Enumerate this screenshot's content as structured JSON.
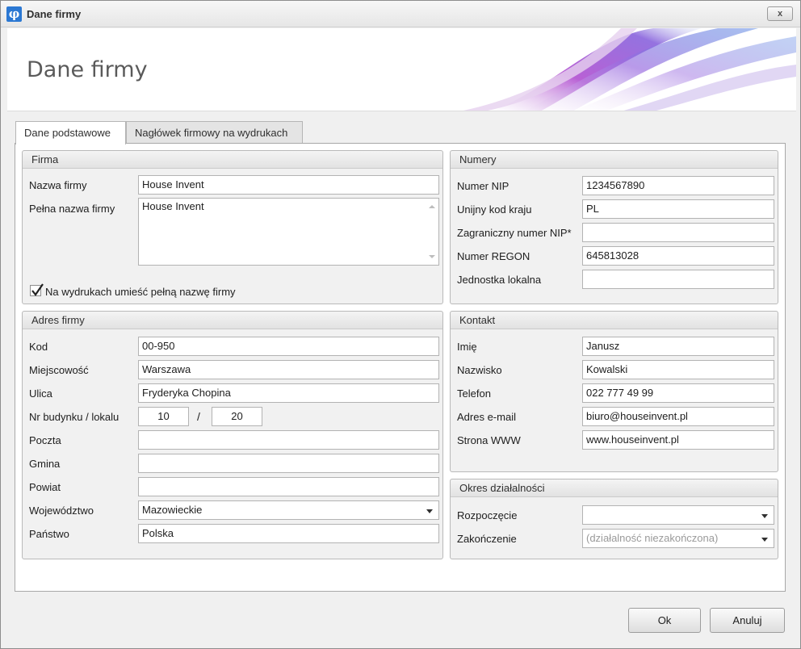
{
  "window": {
    "title": "Dane firmy",
    "close_label": "x"
  },
  "header": {
    "title": "Dane firmy"
  },
  "tabs": [
    {
      "label": "Dane podstawowe"
    },
    {
      "label": "Nagłówek firmowy na wydrukach"
    }
  ],
  "firma": {
    "title": "Firma",
    "nazwa_label": "Nazwa firmy",
    "nazwa_value": "House Invent",
    "pelna_label": "Pełna nazwa firmy",
    "pelna_value": "House Invent",
    "checkbox_label": "Na wydrukach umieść pełną nazwę firmy",
    "checkbox_checked": true
  },
  "numery": {
    "title": "Numery",
    "fields": [
      {
        "label": "Numer NIP",
        "value": "1234567890"
      },
      {
        "label": "Unijny kod kraju",
        "value": "PL"
      },
      {
        "label": "Zagraniczny numer NIP*",
        "value": ""
      },
      {
        "label": "Numer REGON",
        "value": "645813028"
      },
      {
        "label": "Jednostka lokalna",
        "value": ""
      }
    ]
  },
  "adres": {
    "title": "Adres firmy",
    "kod_label": "Kod",
    "kod_value": "00-950",
    "miejscowosc_label": "Miejscowość",
    "miejscowosc_value": "Warszawa",
    "ulica_label": "Ulica",
    "ulica_value": "Fryderyka Chopina",
    "nr_label": "Nr budynku / lokalu",
    "nr_budynku": "10",
    "nr_sep": "/",
    "nr_lokalu": "20",
    "poczta_label": "Poczta",
    "poczta_value": "",
    "gmina_label": "Gmina",
    "gmina_value": "",
    "powiat_label": "Powiat",
    "powiat_value": "",
    "wojewodztwo_label": "Województwo",
    "wojewodztwo_value": "Mazowieckie",
    "panstwo_label": "Państwo",
    "panstwo_value": "Polska"
  },
  "kontakt": {
    "title": "Kontakt",
    "fields": [
      {
        "label": "Imię",
        "value": "Janusz"
      },
      {
        "label": "Nazwisko",
        "value": "Kowalski"
      },
      {
        "label": "Telefon",
        "value": "022 777 49 99"
      },
      {
        "label": "Adres e-mail",
        "value": "biuro@houseinvent.pl"
      },
      {
        "label": "Strona WWW",
        "value": "www.houseinvent.pl"
      }
    ]
  },
  "okres": {
    "title": "Okres działalności",
    "rozpoczecie_label": "Rozpoczęcie",
    "rozpoczecie_value": "",
    "zakonczenie_label": "Zakończenie",
    "zakonczenie_value": "(działalność niezakończona)"
  },
  "buttons": {
    "ok": "Ok",
    "cancel": "Anuluj"
  }
}
